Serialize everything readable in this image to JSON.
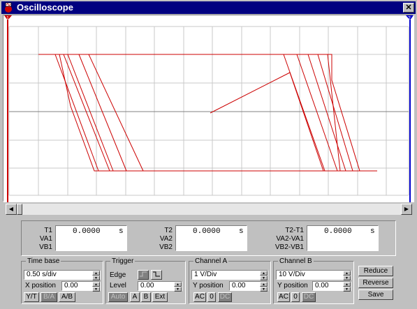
{
  "window": {
    "title": "Oscilloscope",
    "close_label": "✕"
  },
  "screen": {
    "marker_left": "1",
    "marker_right": "2",
    "trace_color": "#cc0000"
  },
  "readout": {
    "block1": {
      "labels": [
        "T1",
        "VA1",
        "VB1"
      ],
      "time": "0.0000",
      "unit": "s"
    },
    "block2": {
      "labels": [
        "T2",
        "VA2",
        "VB2"
      ],
      "time": "0.0000",
      "unit": "s"
    },
    "block3": {
      "labels": [
        "T2-T1",
        "VA2-VA1",
        "VB2-VB1"
      ],
      "time": "0.0000",
      "unit": "s"
    }
  },
  "timebase": {
    "title": "Time base",
    "scale": "0.50 s/div",
    "xpos_label": "X position",
    "xpos": "0.00",
    "modes": [
      "Y/T",
      "B/A",
      "A/B"
    ]
  },
  "trigger": {
    "title": "Trigger",
    "edge_label": "Edge",
    "level_label": "Level",
    "level": "0.00",
    "sources": [
      "Auto",
      "A",
      "B",
      "Ext"
    ]
  },
  "channel_a": {
    "title": "Channel A",
    "scale": "1  V/Div",
    "ypos_label": "Y position",
    "ypos": "0.00",
    "coupling": [
      "AC",
      "0",
      "DC"
    ]
  },
  "channel_b": {
    "title": "Channel B",
    "scale": "10  V/Div",
    "ypos_label": "Y position",
    "ypos": "0.00",
    "coupling": [
      "AC",
      "0",
      "DC"
    ]
  },
  "actions": {
    "reduce": "Reduce",
    "reverse": "Reverse",
    "save": "Save"
  }
}
